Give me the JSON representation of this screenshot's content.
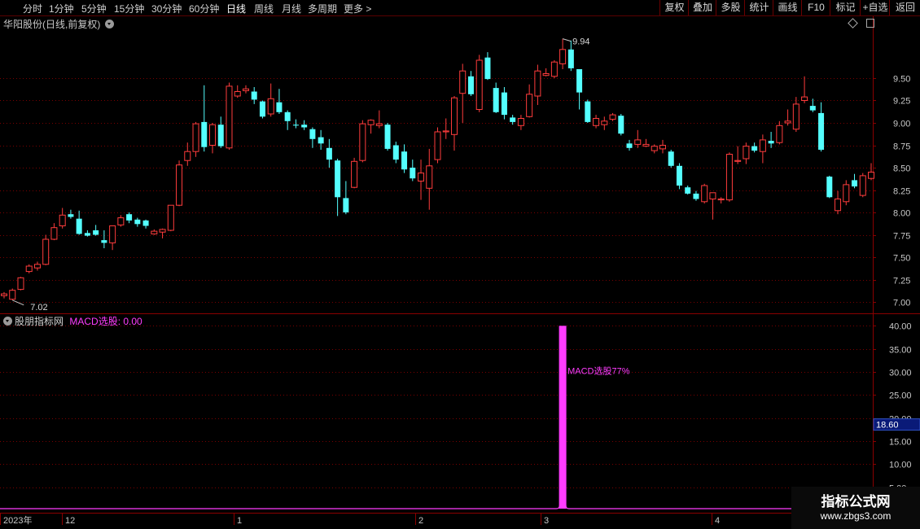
{
  "toolbar": {
    "periods": [
      "分时",
      "1分钟",
      "5分钟",
      "15分钟",
      "30分钟",
      "60分钟",
      "日线",
      "周线",
      "月线",
      "多周期",
      "更多 >"
    ],
    "active_period": "日线",
    "right_buttons": [
      "复权",
      "叠加",
      "多股",
      "统计",
      "画线",
      "F10",
      "标记",
      "+自选",
      "返回"
    ]
  },
  "main_panel": {
    "title": "华阳股份(日线,前复权)",
    "high_label": "9.94",
    "low_label": "7.02",
    "price_ticks": [
      "9.50",
      "9.25",
      "9.00",
      "8.75",
      "8.50",
      "8.25",
      "8.00",
      "7.75",
      "7.50",
      "7.25",
      "7.00"
    ]
  },
  "indicator_panel": {
    "source_name": "股朋指标网",
    "indicator_label": "MACD选股: 0.00",
    "spike_label": "MACD选股77%",
    "ticks": [
      "40.00",
      "35.00",
      "30.00",
      "25.00",
      "20.00",
      "15.00",
      "10.00",
      "5.00"
    ],
    "current_value": "18.60"
  },
  "date_axis": {
    "year_label": "2023年",
    "month_labels": [
      "12",
      "1",
      "2",
      "3",
      "4"
    ]
  },
  "watermark": {
    "title": "指标公式网",
    "url": "www.zbgs3.com"
  },
  "colors": {
    "up": "#ff3c3c",
    "down": "#54ffff",
    "indicator": "#ff3cff",
    "grid": "#7a0000",
    "axis_text": "#c8c8c8"
  },
  "chart_data": {
    "type": "candlestick",
    "price_range": [
      6.9,
      10.1
    ],
    "candles": [
      {
        "o": 7.07,
        "h": 7.11,
        "l": 7.04,
        "c": 7.09
      },
      {
        "o": 7.03,
        "h": 7.15,
        "l": 7.02,
        "c": 7.13
      },
      {
        "o": 7.14,
        "h": 7.28,
        "l": 7.13,
        "c": 7.27
      },
      {
        "o": 7.34,
        "h": 7.42,
        "l": 7.32,
        "c": 7.4
      },
      {
        "o": 7.38,
        "h": 7.45,
        "l": 7.35,
        "c": 7.42
      },
      {
        "o": 7.42,
        "h": 7.75,
        "l": 7.41,
        "c": 7.7
      },
      {
        "o": 7.7,
        "h": 7.88,
        "l": 7.69,
        "c": 7.83
      },
      {
        "o": 7.85,
        "h": 8.05,
        "l": 7.82,
        "c": 7.97
      },
      {
        "o": 7.98,
        "h": 8.03,
        "l": 7.93,
        "c": 7.95
      },
      {
        "o": 7.93,
        "h": 8.02,
        "l": 7.75,
        "c": 7.76
      },
      {
        "o": 7.77,
        "h": 7.8,
        "l": 7.73,
        "c": 7.74
      },
      {
        "o": 7.8,
        "h": 7.86,
        "l": 7.74,
        "c": 7.75
      },
      {
        "o": 7.69,
        "h": 7.8,
        "l": 7.6,
        "c": 7.66
      },
      {
        "o": 7.66,
        "h": 7.85,
        "l": 7.58,
        "c": 7.85
      },
      {
        "o": 7.86,
        "h": 7.97,
        "l": 7.84,
        "c": 7.94
      },
      {
        "o": 7.98,
        "h": 8.0,
        "l": 7.88,
        "c": 7.91
      },
      {
        "o": 7.92,
        "h": 7.94,
        "l": 7.84,
        "c": 7.87
      },
      {
        "o": 7.91,
        "h": 7.92,
        "l": 7.82,
        "c": 7.85
      },
      {
        "o": 7.76,
        "h": 7.81,
        "l": 7.75,
        "c": 7.79
      },
      {
        "o": 7.78,
        "h": 7.82,
        "l": 7.71,
        "c": 7.81
      },
      {
        "o": 7.8,
        "h": 8.08,
        "l": 7.79,
        "c": 8.08
      },
      {
        "o": 8.08,
        "h": 8.58,
        "l": 8.07,
        "c": 8.53
      },
      {
        "o": 8.58,
        "h": 8.78,
        "l": 8.52,
        "c": 8.68
      },
      {
        "o": 8.68,
        "h": 9.01,
        "l": 8.62,
        "c": 8.99
      },
      {
        "o": 9.01,
        "h": 9.42,
        "l": 8.68,
        "c": 8.73
      },
      {
        "o": 8.75,
        "h": 9.0,
        "l": 8.66,
        "c": 8.98
      },
      {
        "o": 8.98,
        "h": 9.07,
        "l": 8.72,
        "c": 8.74
      },
      {
        "o": 8.72,
        "h": 9.45,
        "l": 8.7,
        "c": 9.41
      },
      {
        "o": 9.3,
        "h": 9.42,
        "l": 9.28,
        "c": 9.35
      },
      {
        "o": 9.36,
        "h": 9.42,
        "l": 9.33,
        "c": 9.38
      },
      {
        "o": 9.35,
        "h": 9.4,
        "l": 9.21,
        "c": 9.26
      },
      {
        "o": 9.24,
        "h": 9.25,
        "l": 9.05,
        "c": 9.07
      },
      {
        "o": 9.1,
        "h": 9.44,
        "l": 9.07,
        "c": 9.27
      },
      {
        "o": 9.23,
        "h": 9.38,
        "l": 9.1,
        "c": 9.12
      },
      {
        "o": 9.12,
        "h": 9.14,
        "l": 8.92,
        "c": 9.02
      },
      {
        "o": 8.98,
        "h": 9.04,
        "l": 8.94,
        "c": 8.97
      },
      {
        "o": 8.98,
        "h": 9.03,
        "l": 8.92,
        "c": 8.95
      },
      {
        "o": 8.93,
        "h": 8.95,
        "l": 8.72,
        "c": 8.82
      },
      {
        "o": 8.84,
        "h": 8.92,
        "l": 8.7,
        "c": 8.77
      },
      {
        "o": 8.72,
        "h": 8.82,
        "l": 8.5,
        "c": 8.59
      },
      {
        "o": 8.58,
        "h": 8.6,
        "l": 7.96,
        "c": 8.17
      },
      {
        "o": 8.16,
        "h": 8.35,
        "l": 7.98,
        "c": 8.0
      },
      {
        "o": 8.28,
        "h": 8.61,
        "l": 8.27,
        "c": 8.57
      },
      {
        "o": 8.58,
        "h": 9.03,
        "l": 8.56,
        "c": 8.99
      },
      {
        "o": 8.98,
        "h": 9.04,
        "l": 8.88,
        "c": 9.03
      },
      {
        "o": 8.97,
        "h": 9.14,
        "l": 8.94,
        "c": 8.99
      },
      {
        "o": 8.98,
        "h": 9.0,
        "l": 8.69,
        "c": 8.71
      },
      {
        "o": 8.75,
        "h": 8.79,
        "l": 8.55,
        "c": 8.59
      },
      {
        "o": 8.68,
        "h": 8.76,
        "l": 8.44,
        "c": 8.48
      },
      {
        "o": 8.5,
        "h": 8.59,
        "l": 8.35,
        "c": 8.38
      },
      {
        "o": 8.35,
        "h": 8.59,
        "l": 8.14,
        "c": 8.44
      },
      {
        "o": 8.27,
        "h": 8.71,
        "l": 8.03,
        "c": 8.52
      },
      {
        "o": 8.59,
        "h": 8.95,
        "l": 8.55,
        "c": 8.9
      },
      {
        "o": 8.9,
        "h": 9.05,
        "l": 8.82,
        "c": 8.91
      },
      {
        "o": 8.87,
        "h": 9.3,
        "l": 8.69,
        "c": 9.28
      },
      {
        "o": 9.33,
        "h": 9.66,
        "l": 9.0,
        "c": 9.58
      },
      {
        "o": 9.52,
        "h": 9.58,
        "l": 9.3,
        "c": 9.32
      },
      {
        "o": 9.15,
        "h": 9.76,
        "l": 9.12,
        "c": 9.7
      },
      {
        "o": 9.73,
        "h": 9.79,
        "l": 9.48,
        "c": 9.49
      },
      {
        "o": 9.39,
        "h": 9.45,
        "l": 9.11,
        "c": 9.12
      },
      {
        "o": 9.34,
        "h": 9.4,
        "l": 9.04,
        "c": 9.09
      },
      {
        "o": 9.06,
        "h": 9.09,
        "l": 8.98,
        "c": 9.01
      },
      {
        "o": 8.97,
        "h": 9.09,
        "l": 8.92,
        "c": 9.05
      },
      {
        "o": 9.07,
        "h": 9.43,
        "l": 9.06,
        "c": 9.32
      },
      {
        "o": 9.3,
        "h": 9.65,
        "l": 9.2,
        "c": 9.58
      },
      {
        "o": 9.53,
        "h": 9.61,
        "l": 9.52,
        "c": 9.55
      },
      {
        "o": 9.52,
        "h": 9.7,
        "l": 9.5,
        "c": 9.68
      },
      {
        "o": 9.66,
        "h": 9.94,
        "l": 9.6,
        "c": 9.82
      },
      {
        "o": 9.82,
        "h": 9.92,
        "l": 9.58,
        "c": 9.61
      },
      {
        "o": 9.6,
        "h": 9.6,
        "l": 9.15,
        "c": 9.34
      },
      {
        "o": 9.24,
        "h": 9.26,
        "l": 9.0,
        "c": 9.01
      },
      {
        "o": 8.97,
        "h": 9.09,
        "l": 8.94,
        "c": 9.05
      },
      {
        "o": 8.98,
        "h": 9.07,
        "l": 8.92,
        "c": 9.02
      },
      {
        "o": 9.04,
        "h": 9.11,
        "l": 9.02,
        "c": 9.09
      },
      {
        "o": 9.08,
        "h": 9.1,
        "l": 8.86,
        "c": 8.88
      },
      {
        "o": 8.77,
        "h": 8.81,
        "l": 8.69,
        "c": 8.72
      },
      {
        "o": 8.76,
        "h": 8.92,
        "l": 8.72,
        "c": 8.81
      },
      {
        "o": 8.74,
        "h": 8.82,
        "l": 8.73,
        "c": 8.76
      },
      {
        "o": 8.69,
        "h": 8.76,
        "l": 8.66,
        "c": 8.74
      },
      {
        "o": 8.71,
        "h": 8.81,
        "l": 8.66,
        "c": 8.75
      },
      {
        "o": 8.68,
        "h": 8.7,
        "l": 8.5,
        "c": 8.52
      },
      {
        "o": 8.52,
        "h": 8.55,
        "l": 8.26,
        "c": 8.3
      },
      {
        "o": 8.28,
        "h": 8.3,
        "l": 8.2,
        "c": 8.21
      },
      {
        "o": 8.21,
        "h": 8.24,
        "l": 8.13,
        "c": 8.15
      },
      {
        "o": 8.12,
        "h": 8.32,
        "l": 8.1,
        "c": 8.3
      },
      {
        "o": 8.15,
        "h": 8.22,
        "l": 7.92,
        "c": 8.22
      },
      {
        "o": 8.14,
        "h": 8.17,
        "l": 8.1,
        "c": 8.15
      },
      {
        "o": 8.14,
        "h": 8.67,
        "l": 8.12,
        "c": 8.65
      },
      {
        "o": 8.57,
        "h": 8.74,
        "l": 8.54,
        "c": 8.58
      },
      {
        "o": 8.6,
        "h": 8.78,
        "l": 8.54,
        "c": 8.74
      },
      {
        "o": 8.74,
        "h": 8.78,
        "l": 8.67,
        "c": 8.69
      },
      {
        "o": 8.68,
        "h": 8.87,
        "l": 8.55,
        "c": 8.81
      },
      {
        "o": 8.8,
        "h": 8.9,
        "l": 8.72,
        "c": 8.77
      },
      {
        "o": 8.78,
        "h": 9.02,
        "l": 8.76,
        "c": 8.97
      },
      {
        "o": 9.0,
        "h": 9.15,
        "l": 8.97,
        "c": 9.02
      },
      {
        "o": 8.93,
        "h": 9.29,
        "l": 8.9,
        "c": 9.21
      },
      {
        "o": 9.25,
        "h": 9.52,
        "l": 9.22,
        "c": 9.29
      },
      {
        "o": 9.19,
        "h": 9.27,
        "l": 9.12,
        "c": 9.14
      },
      {
        "o": 9.11,
        "h": 9.23,
        "l": 8.68,
        "c": 8.7
      },
      {
        "o": 8.4,
        "h": 8.41,
        "l": 8.16,
        "c": 8.17
      },
      {
        "o": 8.02,
        "h": 8.24,
        "l": 7.98,
        "c": 8.15
      },
      {
        "o": 8.12,
        "h": 8.36,
        "l": 8.08,
        "c": 8.31
      },
      {
        "o": 8.36,
        "h": 8.43,
        "l": 8.27,
        "c": 8.29
      },
      {
        "o": 8.19,
        "h": 8.44,
        "l": 8.17,
        "c": 8.41
      },
      {
        "o": 8.38,
        "h": 8.55,
        "l": 8.36,
        "c": 8.45
      }
    ],
    "indicator_series": {
      "name": "MACD选股",
      "spike_index": 67,
      "spike_value": 40.0,
      "base_value": 0.0,
      "y_range": [
        0,
        42
      ]
    }
  }
}
